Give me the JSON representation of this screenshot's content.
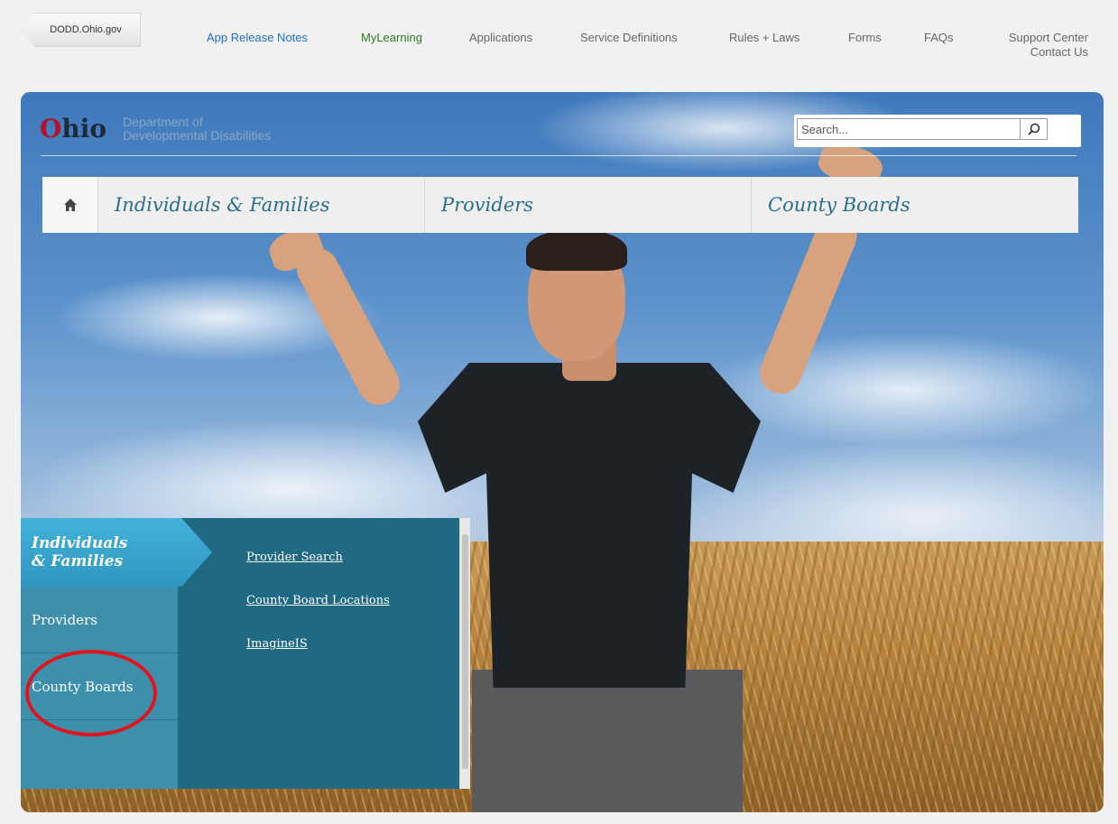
{
  "gov_tab": {
    "label": "DODD.Ohio.gov"
  },
  "top_links": {
    "app_release_notes": "App Release Notes",
    "mylearning": "MyLearning",
    "applications": "Applications",
    "service_definitions": "Service Definitions",
    "rules_laws": "Rules + Laws",
    "forms": "Forms",
    "faqs": "FAQs",
    "support_center": "Support Center",
    "contact_us": "Contact Us"
  },
  "header": {
    "logo_o": "O",
    "logo_rest": "hio",
    "logo_line1": "Department of",
    "logo_line2": "Developmental Disabilities",
    "search_placeholder": "Search..."
  },
  "main_nav": {
    "home_icon": "home-icon",
    "items": [
      "Individuals & Families",
      "Providers",
      "County Boards"
    ]
  },
  "audience_panel": {
    "active_tab_line1": "Individuals",
    "active_tab_line2": "& Families",
    "tabs": [
      "Providers",
      "County Boards"
    ],
    "links": [
      "Provider Search",
      "County Board Locations",
      "ImagineIS"
    ]
  },
  "colors": {
    "link_blue": "#1a72c4",
    "link_green": "#2c7a1e",
    "panel_teal": "#1f6a82",
    "active_tab": "#3aa7d0",
    "annotation_red": "#e0141c"
  }
}
